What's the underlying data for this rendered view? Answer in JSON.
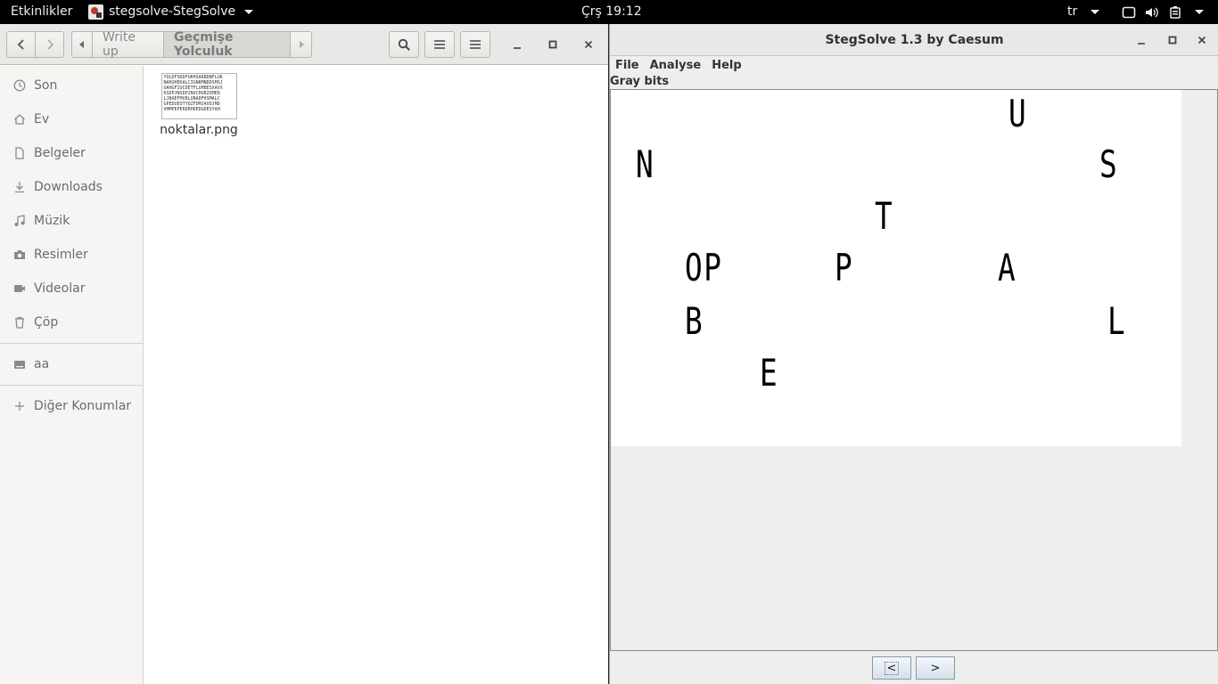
{
  "topbar": {
    "activities": "Etkinlikler",
    "app_name": "stegsolve-StegSolve",
    "clock": "Çrş 19:12",
    "language": "tr"
  },
  "files": {
    "breadcrumbs": [
      "Write up",
      "Geçmişe Yolculuk"
    ],
    "sidebar": {
      "items": [
        {
          "label": "Son",
          "icon": "clock-icon"
        },
        {
          "label": "Ev",
          "icon": "home-icon"
        },
        {
          "label": "Belgeler",
          "icon": "document-icon"
        },
        {
          "label": "Downloads",
          "icon": "download-icon"
        },
        {
          "label": "Müzik",
          "icon": "music-icon"
        },
        {
          "label": "Resimler",
          "icon": "camera-icon"
        },
        {
          "label": "Videolar",
          "icon": "video-icon"
        },
        {
          "label": "Çöp",
          "icon": "trash-icon"
        }
      ],
      "devices": [
        {
          "label": "aa",
          "icon": "drive-icon"
        }
      ],
      "other": {
        "label": "Diğer Konumlar",
        "icon": "plus-icon"
      }
    },
    "file": {
      "name": "noktalar.png",
      "thumb_lines": [
        "YOLDFSKDFUKHSAKBDNFLUK",
        "NAKUHEKALCIGNKMNDDSMSJ",
        "UAHGFIUCDETFLUHBESXAVX",
        "KSDPJNSDPINVCHURZXMER",
        "LJBAEFMVBLUBADFKSMALC",
        "GPEDUEOTYDZFDMJAVDJMD",
        "VHMPEPERDRHDEDGDESYAH"
      ]
    }
  },
  "steg": {
    "title": "StegSolve 1.3 by Caesum",
    "menu": [
      "File",
      "Analyse",
      "Help"
    ],
    "mode_label": "Gray bits",
    "glyphs": [
      "U",
      "N",
      "S",
      "T",
      "OP",
      "P",
      "A",
      "B",
      "L",
      "E"
    ],
    "prev_label": "<",
    "next_label": ">"
  }
}
